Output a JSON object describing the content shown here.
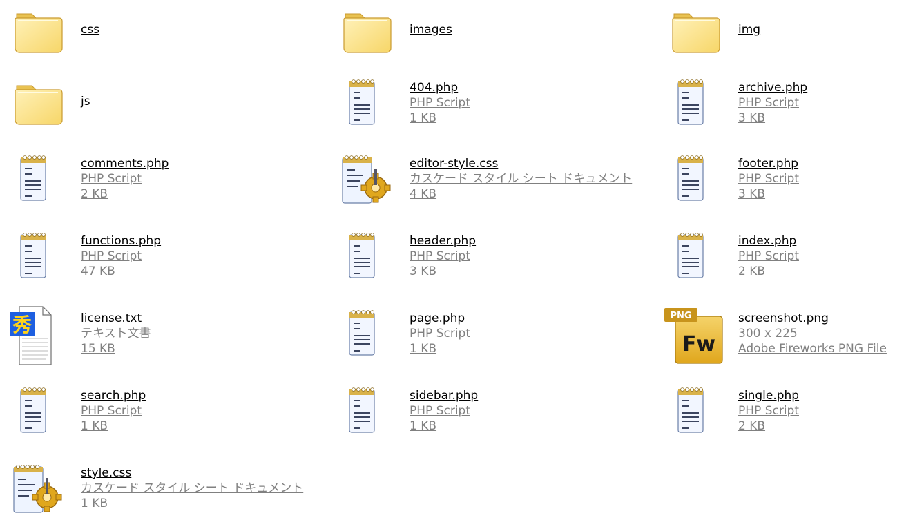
{
  "files": [
    {
      "name": "css",
      "icon": "folder-icon",
      "lines": []
    },
    {
      "name": "images",
      "icon": "folder-icon",
      "lines": []
    },
    {
      "name": "img",
      "icon": "folder-icon",
      "lines": []
    },
    {
      "name": "js",
      "icon": "folder-icon",
      "lines": []
    },
    {
      "name": "404.php",
      "icon": "php-script-icon",
      "lines": [
        "PHP Script",
        "1 KB"
      ]
    },
    {
      "name": "archive.php",
      "icon": "php-script-icon",
      "lines": [
        "PHP Script",
        "3 KB"
      ]
    },
    {
      "name": "comments.php",
      "icon": "php-script-icon",
      "lines": [
        "PHP Script",
        "2 KB"
      ]
    },
    {
      "name": "editor-style.css",
      "icon": "css-document-icon",
      "lines": [
        "カスケード スタイル シート ドキュメント",
        "4 KB"
      ]
    },
    {
      "name": "footer.php",
      "icon": "php-script-icon",
      "lines": [
        "PHP Script",
        "3 KB"
      ]
    },
    {
      "name": "functions.php",
      "icon": "php-script-icon",
      "lines": [
        "PHP Script",
        "47 KB"
      ]
    },
    {
      "name": "header.php",
      "icon": "php-script-icon",
      "lines": [
        "PHP Script",
        "3 KB"
      ]
    },
    {
      "name": "index.php",
      "icon": "php-script-icon",
      "lines": [
        "PHP Script",
        "2 KB"
      ]
    },
    {
      "name": "license.txt",
      "icon": "text-document-icon",
      "lines": [
        "テキスト文書",
        "15 KB"
      ]
    },
    {
      "name": "page.php",
      "icon": "php-script-icon",
      "lines": [
        "PHP Script",
        "1 KB"
      ]
    },
    {
      "name": "screenshot.png",
      "icon": "fireworks-png-icon",
      "lines": [
        "300 x 225",
        "Adobe Fireworks PNG File"
      ]
    },
    {
      "name": "search.php",
      "icon": "php-script-icon",
      "lines": [
        "PHP Script",
        "1 KB"
      ]
    },
    {
      "name": "sidebar.php",
      "icon": "php-script-icon",
      "lines": [
        "PHP Script",
        "1 KB"
      ]
    },
    {
      "name": "single.php",
      "icon": "php-script-icon",
      "lines": [
        "PHP Script",
        "2 KB"
      ]
    },
    {
      "name": "style.css",
      "icon": "css-document-icon",
      "lines": [
        "カスケード スタイル シート ドキュメント",
        "1 KB"
      ]
    }
  ],
  "icon_labels": {
    "fireworks_badge": "PNG",
    "fireworks_mark": "Fw",
    "text_doc_glyph": "秀"
  },
  "colors": {
    "folder": "#F7D668",
    "folder_edge": "#C99A2E",
    "meta_text": "#808080",
    "fw_gold": "#E0A71D"
  }
}
